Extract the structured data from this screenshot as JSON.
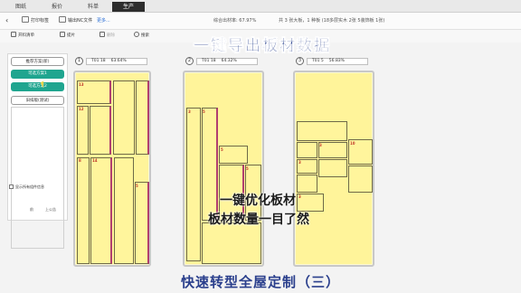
{
  "tabs": [
    {
      "label": "图纸",
      "active": false
    },
    {
      "label": "报价",
      "active": false
    },
    {
      "label": "料单",
      "active": false
    },
    {
      "label": "生产",
      "active": true
    }
  ],
  "toolbar": {
    "back_icon": "back-arrow-icon",
    "print_label": "打印标签",
    "export_label": "输出NC文件",
    "more_label": "更多...",
    "utilization": "综合出材率: 67.97%",
    "summary": "共 3 张大板，1 种板 (18多层实木 2张 5装饰板 1张)"
  },
  "toolbar2": {
    "cut_list": "开料清单",
    "settings": "提片",
    "delete": "删除",
    "search": "搜索"
  },
  "headline": "一键导出板材数据",
  "left_panel": {
    "buttons": [
      {
        "label": "推荐方案(新)",
        "style": "outline"
      },
      {
        "label": "可选方案1",
        "style": "teal"
      },
      {
        "label": "可选方案2",
        "style": "teal"
      },
      {
        "label": "旧排版(测试)",
        "style": "outline"
      }
    ],
    "checkbox_label": "显示所有组件信息",
    "pager_prev": "前",
    "pager_next": "上公告"
  },
  "boards": [
    {
      "num": "1",
      "material": "T01 18",
      "rate": "63.64%"
    },
    {
      "num": "2",
      "material": "T01 18",
      "rate": "64.32%"
    },
    {
      "num": "3",
      "material": "T01 5",
      "rate": "56.83%"
    }
  ],
  "caption_line1": "一键优化板材",
  "caption_line2": "板材数量一目了然",
  "footer": "快速转型全屋定制（三）",
  "colors": {
    "accent_teal": "#1fa58f",
    "active_tab": "#2d2d2d",
    "board_fill": "#fff49a",
    "headline": "#233c8a"
  }
}
